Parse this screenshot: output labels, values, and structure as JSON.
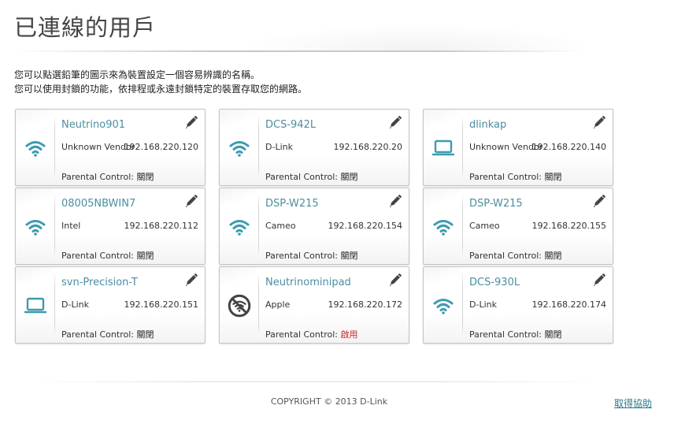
{
  "page": {
    "title": "已連線的用戶",
    "instruction_line1": "您可以點選鉛筆的圖示來為裝置設定一個容易辨識的名稱。",
    "instruction_line2": "您可以使用封鎖的功能，依排程或永遠封鎖特定的裝置存取您的網路。"
  },
  "colors": {
    "accent": "#4a8fa0",
    "icon": "#3d9bb0",
    "blocked_icon": "#444444",
    "enabled_status": "#cc2222"
  },
  "parental_control_label": "Parental Control:",
  "devices": [
    {
      "name": "Neutrino901",
      "vendor": "Unknown Vendor",
      "ip": "192.168.220.120",
      "parental_status": "關閉",
      "icon": "wifi-icon"
    },
    {
      "name": "DCS-942L",
      "vendor": "D-Link",
      "ip": "192.168.220.20",
      "parental_status": "關閉",
      "icon": "wifi-icon"
    },
    {
      "name": "dlinkap",
      "vendor": "Unknown Vendor",
      "ip": "192.168.220.140",
      "parental_status": "關閉",
      "icon": "laptop-icon"
    },
    {
      "name": "08005NBWIN7",
      "vendor": "Intel",
      "ip": "192.168.220.112",
      "parental_status": "關閉",
      "icon": "wifi-icon"
    },
    {
      "name": "DSP-W215",
      "vendor": "Cameo",
      "ip": "192.168.220.154",
      "parental_status": "關閉",
      "icon": "wifi-icon"
    },
    {
      "name": "DSP-W215",
      "vendor": "Cameo",
      "ip": "192.168.220.155",
      "parental_status": "關閉",
      "icon": "wifi-icon"
    },
    {
      "name": "svn-Precision-T",
      "vendor": "D-Link",
      "ip": "192.168.220.151",
      "parental_status": "關閉",
      "icon": "laptop-icon"
    },
    {
      "name": "Neutrinominipad",
      "vendor": "Apple",
      "ip": "192.168.220.172",
      "parental_status": "啟用",
      "icon": "blocked-wifi-icon"
    },
    {
      "name": "DCS-930L",
      "vendor": "D-Link",
      "ip": "192.168.220.174",
      "parental_status": "關閉",
      "icon": "wifi-icon"
    }
  ],
  "footer": {
    "copyright": "COPYRIGHT © 2013 D-Link",
    "help": "取得協助"
  }
}
